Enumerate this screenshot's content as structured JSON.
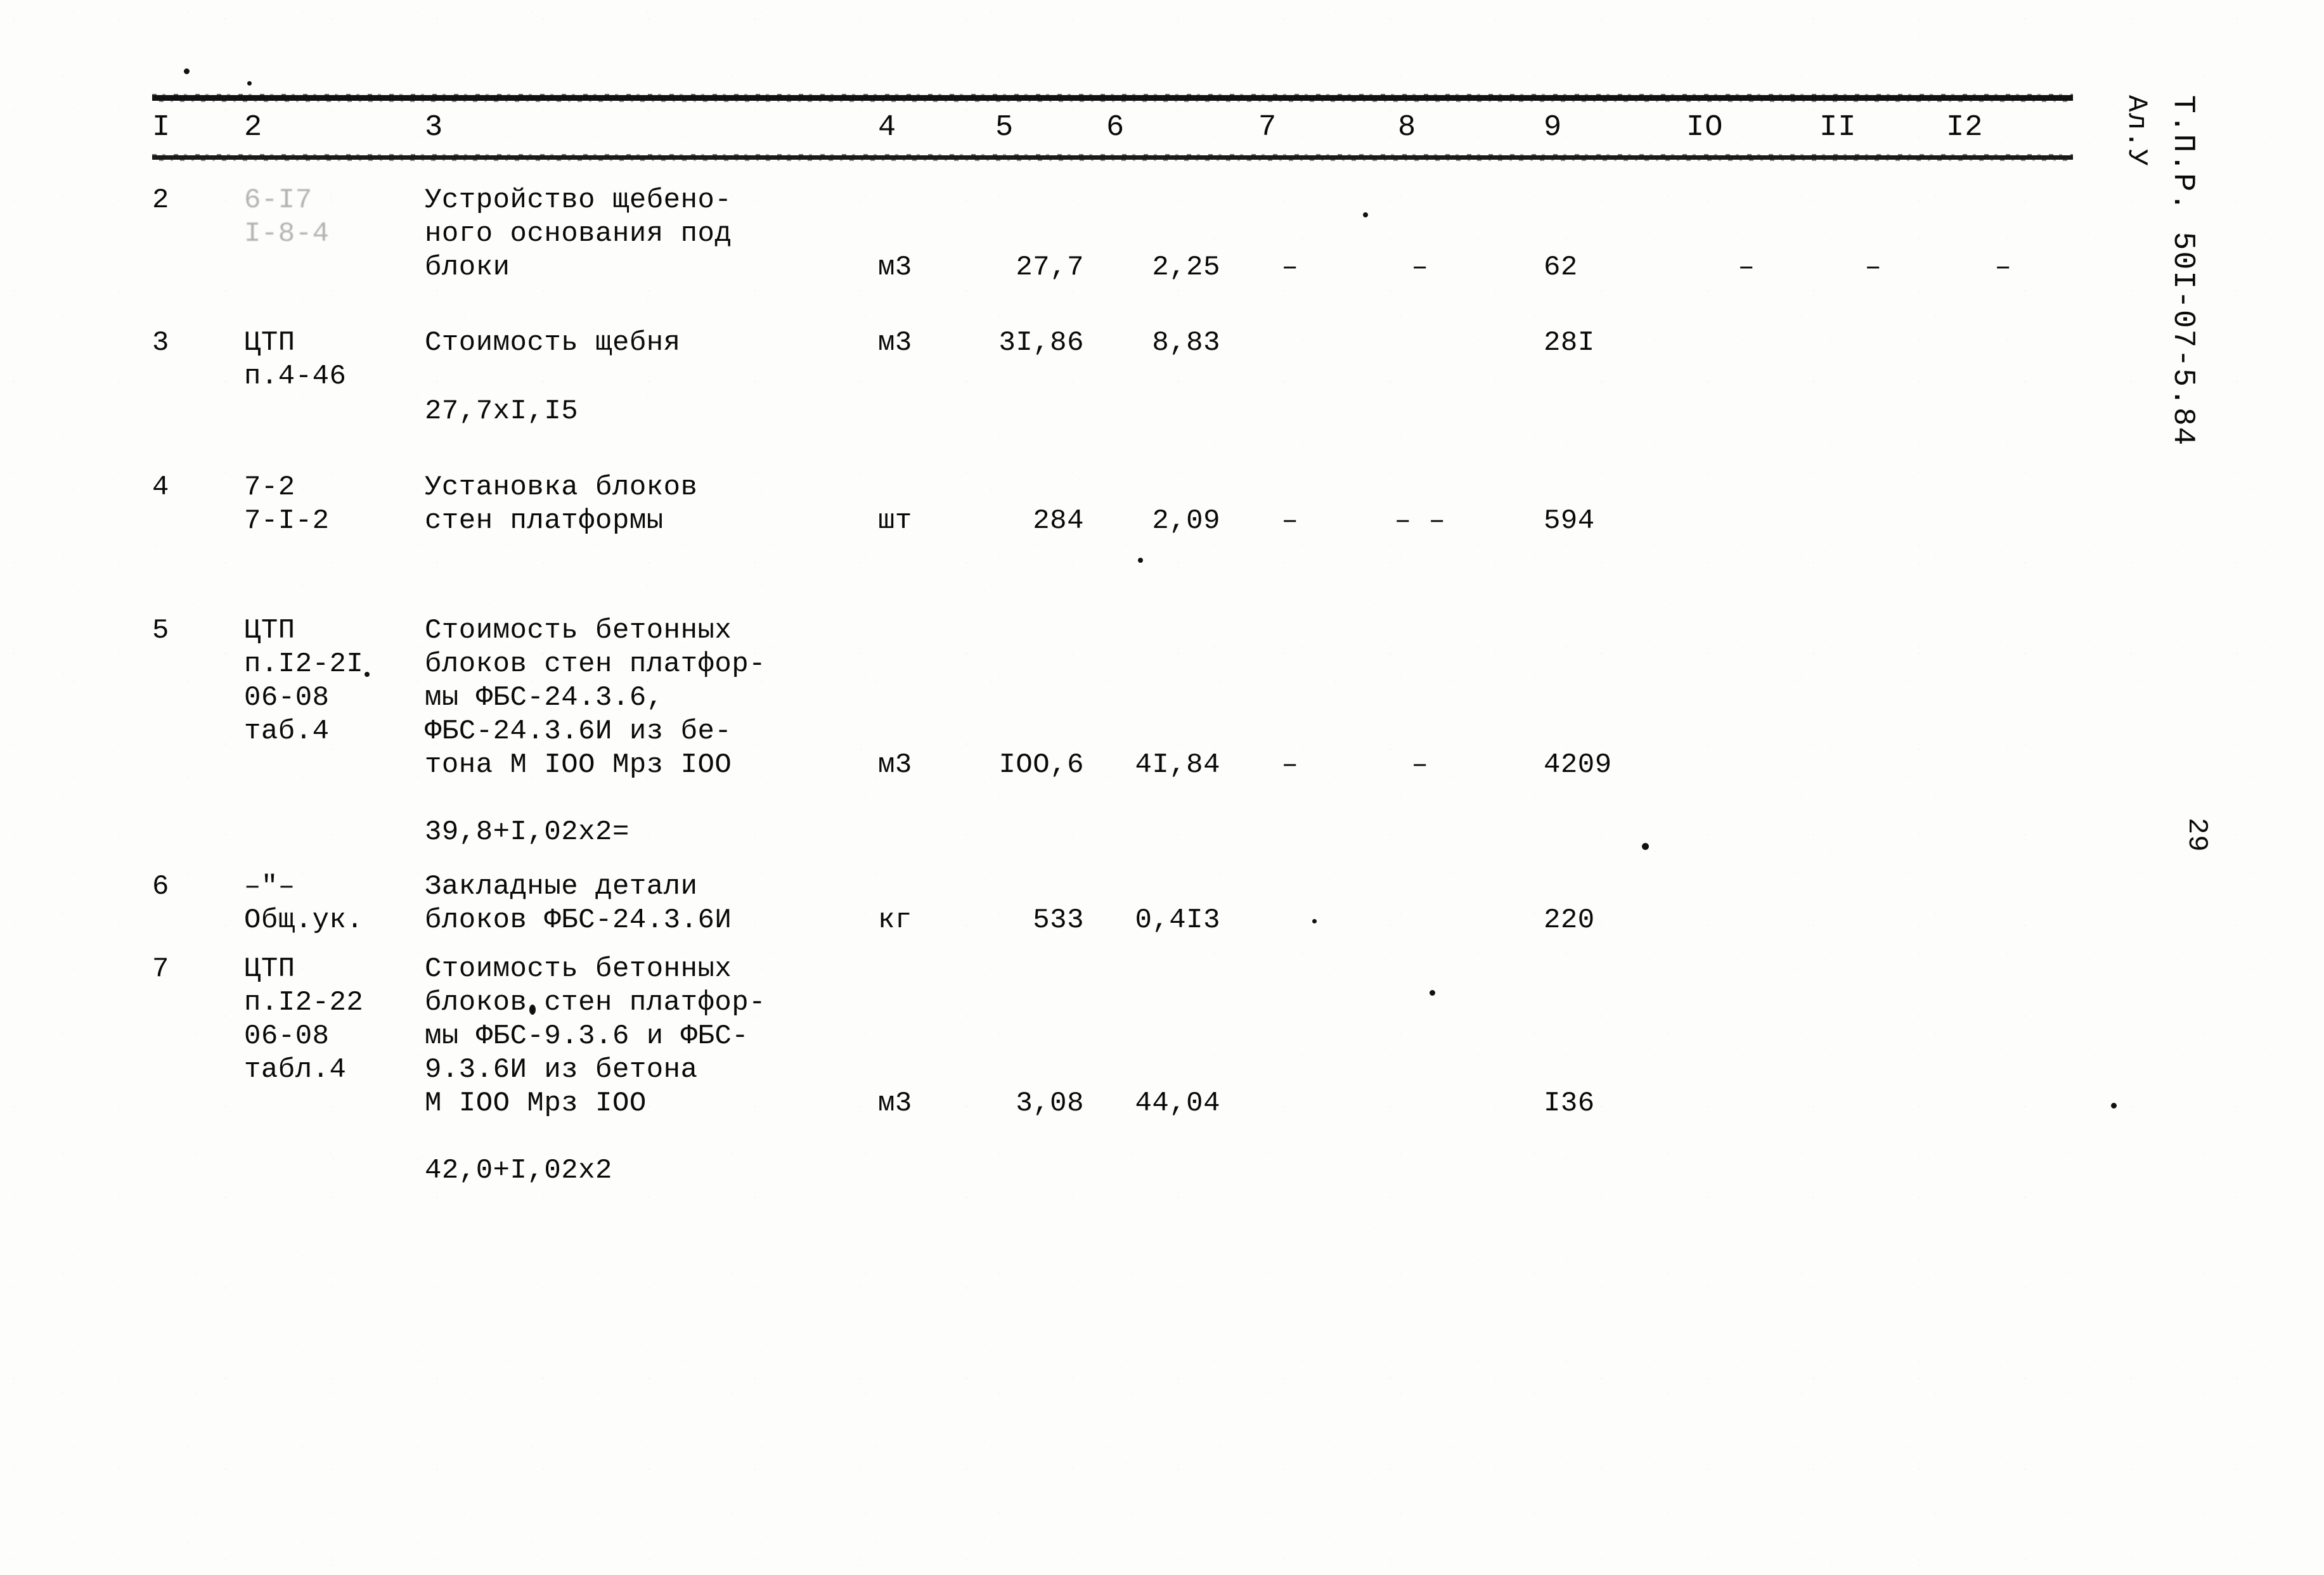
{
  "document": {
    "type": "scanned-technical-estimate-table",
    "language": "ru",
    "side_imprint_code": "Т.П.Р. 50I-07-5.84",
    "side_imprint_album": "Ал.У",
    "page_number": "29"
  },
  "table": {
    "column_headers": [
      "I",
      "2",
      "3",
      "4",
      "5",
      "6",
      "7",
      "8",
      "9",
      "IO",
      "II",
      "I2"
    ],
    "rows": [
      {
        "num": "2",
        "code": "6-I7\nI-8-4",
        "description": "Устройство щебено-\nного основания под\nблоки",
        "unit": "м3",
        "c5": "27,7",
        "c6": "2,25",
        "c7": "–",
        "c8": "–",
        "c9": "62",
        "c10": "–",
        "c11": "–",
        "c12": "–",
        "formula": "",
        "code_faded": true
      },
      {
        "num": "3",
        "code": "ЦТП\nп.4-46",
        "description": "Стоимость щебня",
        "unit": "м3",
        "c5": "3I,86",
        "c6": "8,83",
        "c7": "",
        "c8": "",
        "c9": "28I",
        "c10": "",
        "c11": "",
        "c12": "",
        "formula": "27,7xI,I5",
        "code_faded": false
      },
      {
        "num": "4",
        "code": "7-2\n7-I-2",
        "description": "Установка блоков\nстен платформы",
        "unit": "шт",
        "c5": "284",
        "c6": "2,09",
        "c7": "–",
        "c8": "–  –",
        "c9": "594",
        "c10": "",
        "c11": "",
        "c12": "",
        "formula": "",
        "code_faded": false
      },
      {
        "num": "5",
        "code": "ЦТП\nп.I2-2I\n06-08\nтаб.4",
        "description": "Стоимость бетонных\nблоков стен платфор-\nмы ФБС-24.3.6,\nФБС-24.3.6И из бе-\nтона М IOO Мрз IOO",
        "unit": "м3",
        "c5": "IOO,6",
        "c6": "4I,84",
        "c7": "–",
        "c8": "–",
        "c9": "4209",
        "c10": "",
        "c11": "",
        "c12": "",
        "formula": "39,8+I,02x2=",
        "code_faded": false
      },
      {
        "num": "6",
        "code": "–\"–\nОбщ.ук.",
        "description": "Закладные детали\nблоков ФБС-24.3.6И",
        "unit": "кг",
        "c5": "533",
        "c6": "0,4I3",
        "c7": "",
        "c8": "",
        "c9": "220",
        "c10": "",
        "c11": "",
        "c12": "",
        "formula": "",
        "code_faded": false
      },
      {
        "num": "7",
        "code": "ЦТП\nп.I2-22\n06-08\nтабл.4",
        "description": "Стоимость бетонных\nблоков стен платфор-\nмы ФБС-9.3.6 и ФБС-\n9.3.6И из бетона\nМ IOO Мрз IOO",
        "unit": "м3",
        "c5": "3,08",
        "c6": "44,04",
        "c7": "",
        "c8": "",
        "c9": "I36",
        "c10": "",
        "c11": "",
        "c12": "",
        "formula": "42,0+I,02x2",
        "code_faded": false
      }
    ]
  }
}
